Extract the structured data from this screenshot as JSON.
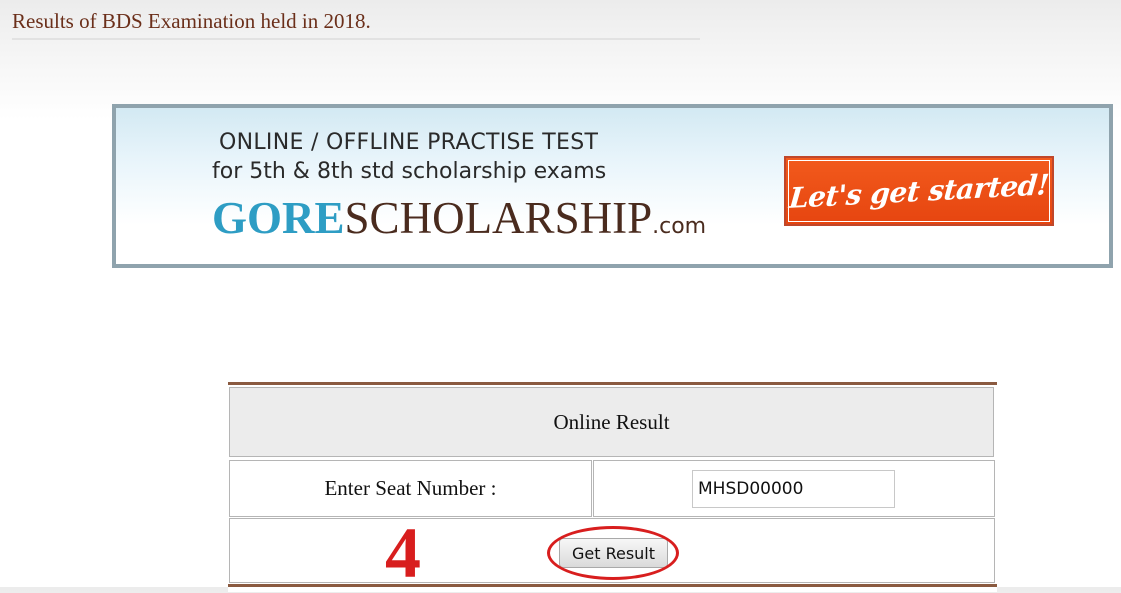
{
  "page": {
    "heading": "Results of BDS Examination held in 2018."
  },
  "banner": {
    "line1": "ONLINE / OFFLINE PRACTISE TEST",
    "line2": "for 5th & 8th std scholarship exams",
    "brand_part1": "GORE",
    "brand_part2": "SCHOLARSHIP",
    "brand_suffix": ".com",
    "cta_label": "Let's get started!",
    "colors": {
      "brand_blue": "#2e9dc4",
      "brand_brown": "#4a2b1e",
      "cta_orange": "#f25a1c"
    }
  },
  "result_form": {
    "header": "Online Result",
    "seat_label": "Enter Seat Number :",
    "seat_value": "MHSD00000",
    "step_marker": "4",
    "submit_label": "Get Result",
    "highlight_color": "#d81e1e"
  }
}
